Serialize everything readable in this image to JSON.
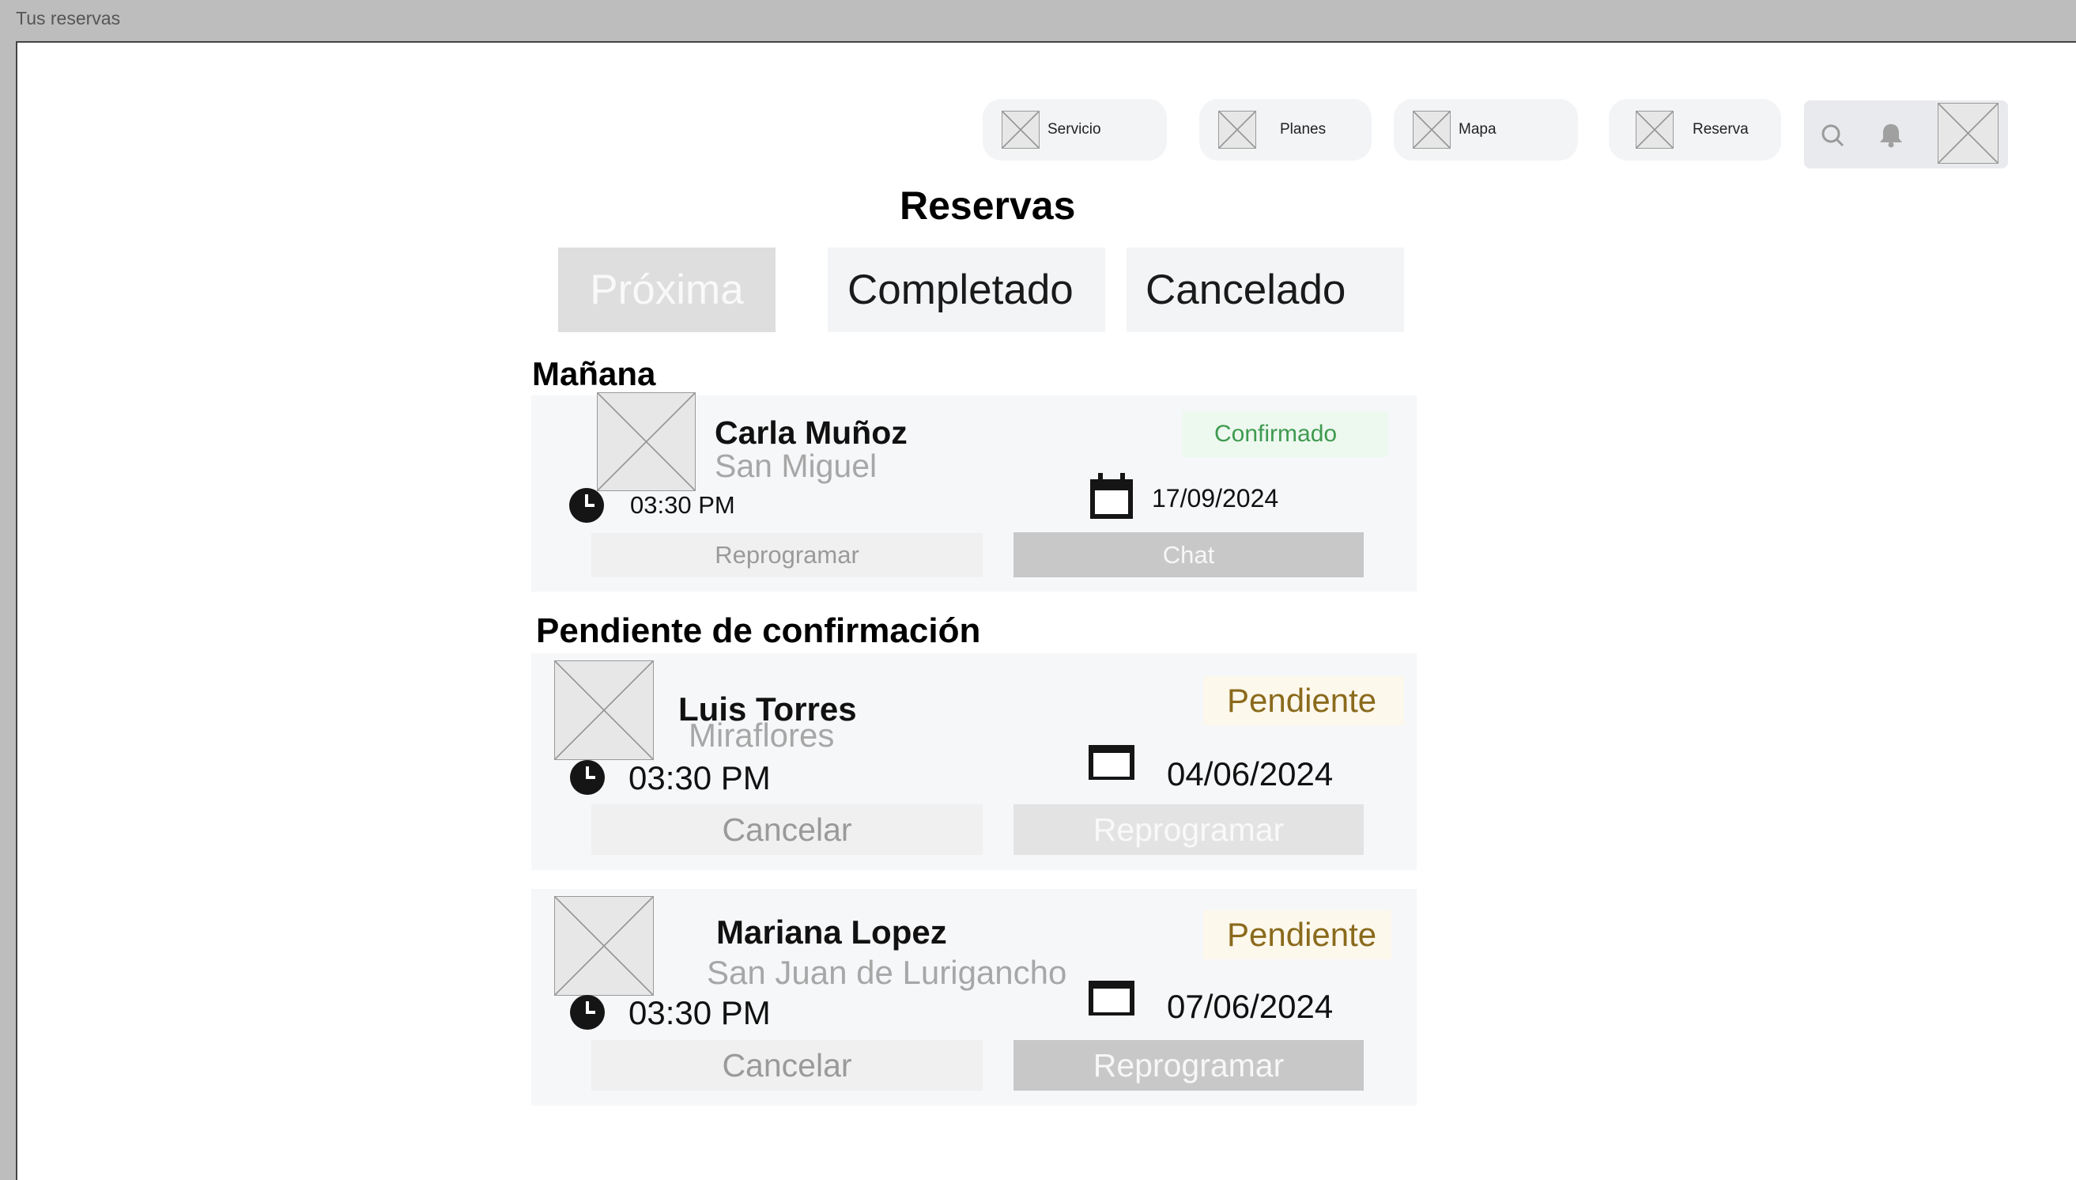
{
  "window": {
    "title": "Tus reservas"
  },
  "nav": {
    "items": [
      {
        "label": "Servicio"
      },
      {
        "label": "Planes"
      },
      {
        "label": "Mapa"
      },
      {
        "label": "Reserva"
      }
    ],
    "icons": [
      "search-icon",
      "bell-icon",
      "avatar"
    ]
  },
  "page": {
    "title": "Reservas"
  },
  "tabs": [
    {
      "label": "Próxima",
      "active": true
    },
    {
      "label": "Completado"
    },
    {
      "label": "Cancelado"
    }
  ],
  "sections": [
    {
      "title": "Mañana",
      "bookings": [
        {
          "name": "Carla Muñoz",
          "location": "San Miguel",
          "status": "Confirmado",
          "time": "03:30 PM",
          "date": "17/09/2024",
          "left_button": "Reprogramar",
          "right_button": "Chat"
        }
      ]
    },
    {
      "title": "Pendiente de confirmación",
      "bookings": [
        {
          "name": "Luis Torres",
          "location": "Miraflores",
          "status": "Pendiente",
          "time": "03:30 PM",
          "date": "04/06/2024",
          "left_button": "Cancelar",
          "right_button": "Reprogramar"
        },
        {
          "name": "Mariana Lopez",
          "location": "San Juan de Lurigancho",
          "status": "Pendiente",
          "time": "03:30 PM",
          "date": "07/06/2024",
          "left_button": "Cancelar",
          "right_button": "Reprogramar"
        }
      ]
    }
  ],
  "colors": {
    "confirmed": "#3f9a4f",
    "pending": "#8a6a1c",
    "pending_bg": "#fdf8ec",
    "confirmed_bg": "#edf8ef"
  }
}
